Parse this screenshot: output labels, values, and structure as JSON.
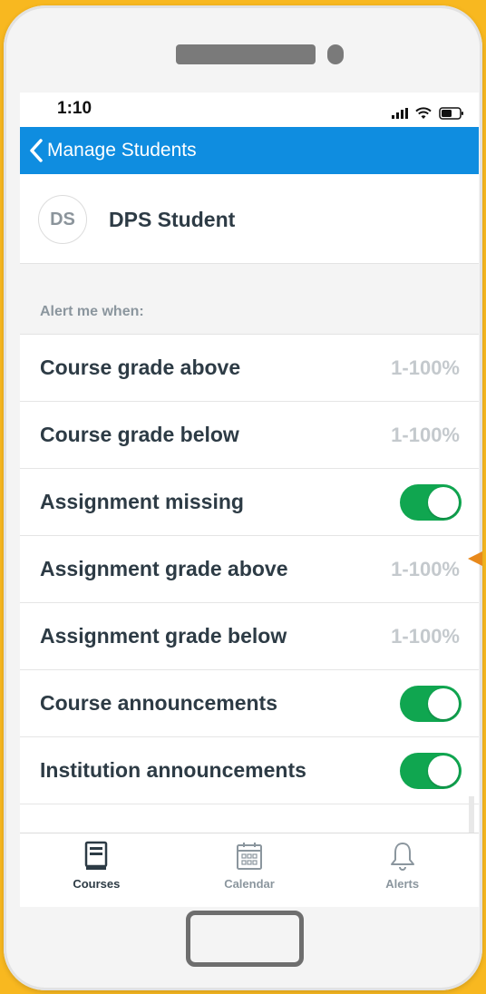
{
  "status_bar": {
    "time": "1:10"
  },
  "nav": {
    "back_label": "Manage Students",
    "color": "#0f8de0"
  },
  "student": {
    "initials": "DS",
    "name": "DPS Student"
  },
  "alerts": {
    "section_label": "Alert me when:",
    "rows": [
      {
        "label": "Course grade above",
        "kind": "range",
        "value": "1-100%"
      },
      {
        "label": "Course grade below",
        "kind": "range",
        "value": "1-100%"
      },
      {
        "label": "Assignment missing",
        "kind": "toggle",
        "on": true
      },
      {
        "label": "Assignment grade above",
        "kind": "range",
        "value": "1-100%"
      },
      {
        "label": "Assignment grade below",
        "kind": "range",
        "value": "1-100%"
      },
      {
        "label": "Course announcements",
        "kind": "toggle",
        "on": true
      },
      {
        "label": "Institution announcements",
        "kind": "toggle",
        "on": true
      }
    ]
  },
  "tabs": [
    {
      "label": "Courses",
      "icon": "book-icon",
      "active": true
    },
    {
      "label": "Calendar",
      "icon": "calendar-icon",
      "active": false
    },
    {
      "label": "Alerts",
      "icon": "bell-icon",
      "active": false
    }
  ],
  "colors": {
    "toggle_on": "#10a650",
    "tab_active": "#2d3b45",
    "tab_inactive": "#8b969e"
  }
}
